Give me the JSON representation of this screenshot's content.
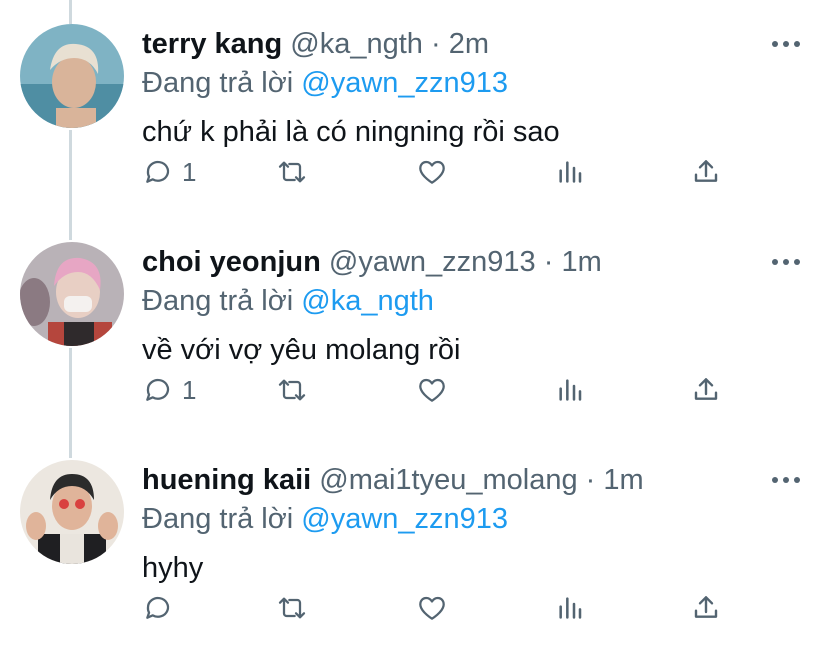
{
  "replying_to_label": "Đang trả lời",
  "tweets": [
    {
      "name": "terry kang",
      "handle": "@ka_ngth",
      "separator": "·",
      "time": "2m",
      "replying_to": "@yawn_zzn913",
      "text": "chứ k phải là có ningning rồi sao",
      "reply_count": "1",
      "avatar_colors": {
        "bg": "#6aa6b8",
        "skin": "#d9b49a",
        "hair": "#e8e0d2"
      }
    },
    {
      "name": "choi yeonjun",
      "handle": "@yawn_zzn913",
      "separator": "·",
      "time": "1m",
      "replying_to": "@ka_ngth",
      "text": "về với vợ yêu molang rồi",
      "reply_count": "1",
      "avatar_colors": {
        "bg": "#c9c3c7",
        "skin": "#e8cfc4",
        "hair": "#e7a6c4"
      }
    },
    {
      "name": "huening kaii",
      "handle": "@mai1tyeu_molang",
      "separator": "·",
      "time": "1m",
      "replying_to": "@yawn_zzn913",
      "text": "hyhy",
      "reply_count": "",
      "avatar_colors": {
        "bg": "#e9e4dd",
        "skin": "#e0b49a",
        "hair": "#2b2b2b"
      }
    }
  ],
  "colors": {
    "mention": "#1d9bf0",
    "muted": "#536471",
    "thread_line": "#cfd9de"
  }
}
